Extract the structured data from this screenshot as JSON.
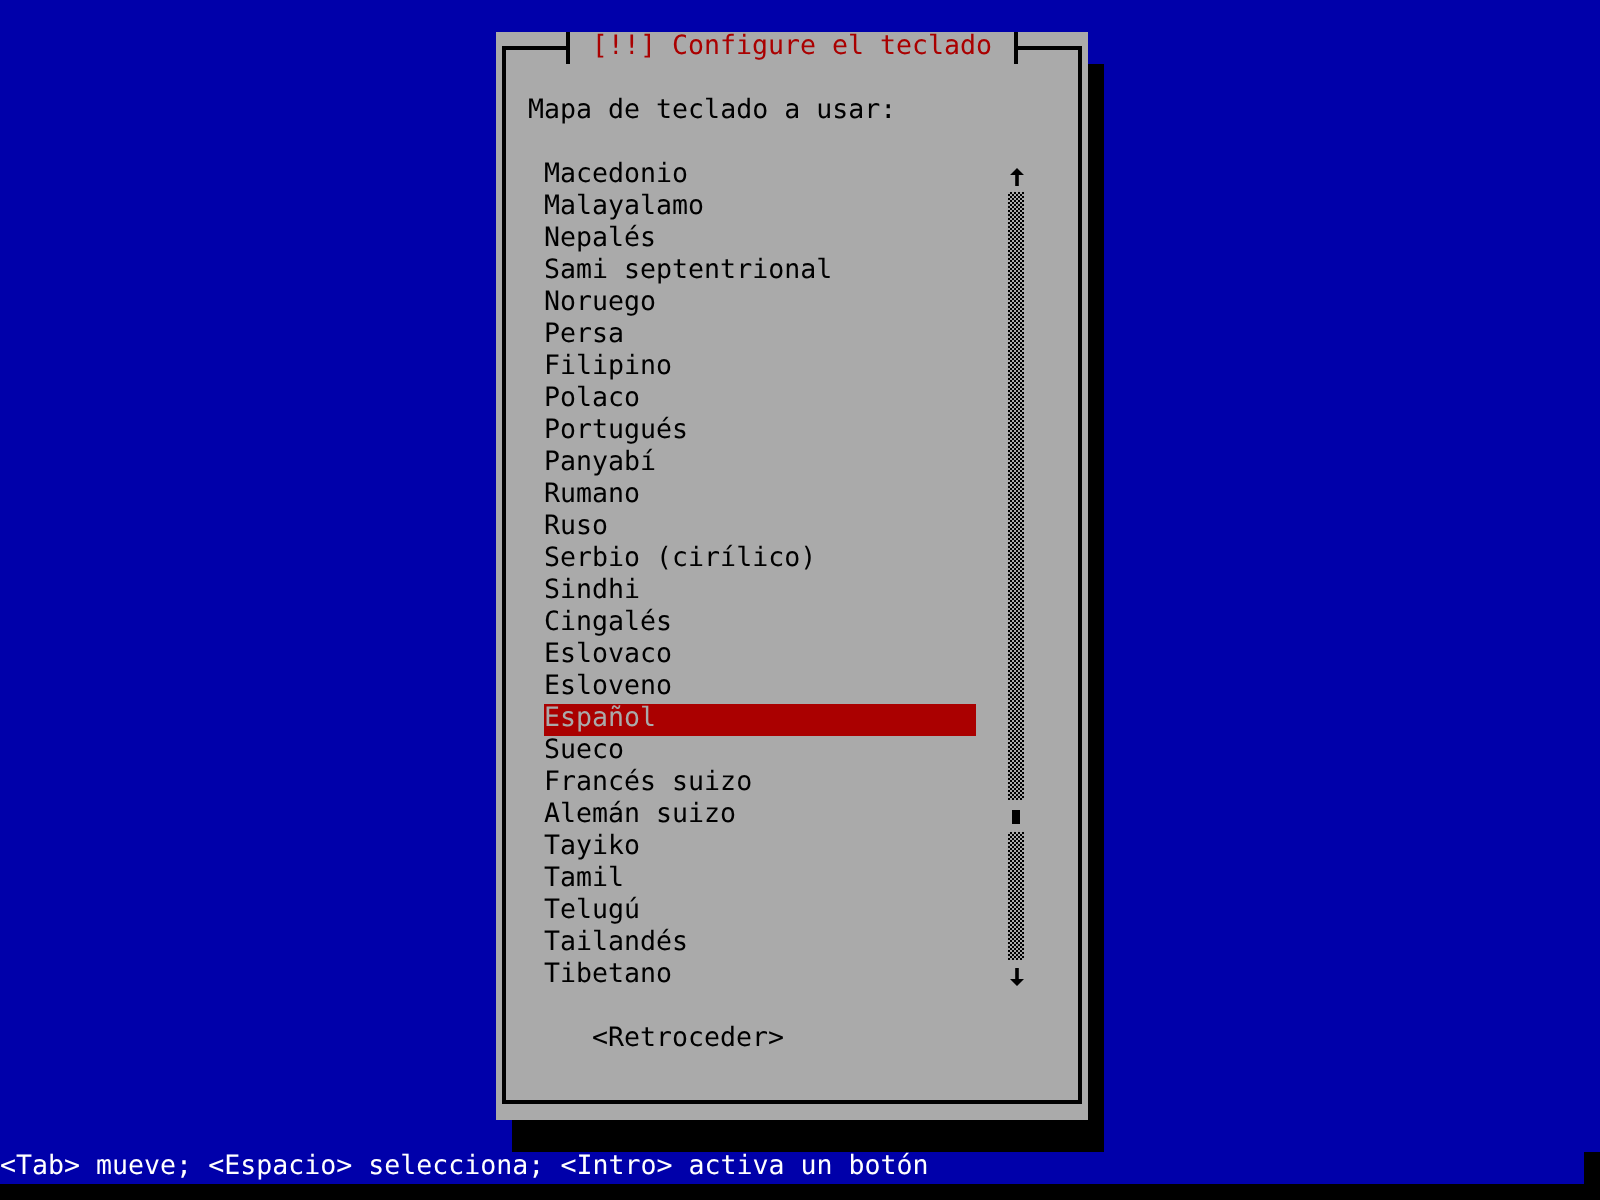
{
  "dialog": {
    "title": "[!!] Configure el teclado",
    "prompt": "Mapa de teclado a usar:",
    "keymaps": [
      {
        "label": "Macedonio",
        "selected": false
      },
      {
        "label": "Malayalamo",
        "selected": false
      },
      {
        "label": "Nepalés",
        "selected": false
      },
      {
        "label": "Sami septentrional",
        "selected": false
      },
      {
        "label": "Noruego",
        "selected": false
      },
      {
        "label": "Persa",
        "selected": false
      },
      {
        "label": "Filipino",
        "selected": false
      },
      {
        "label": "Polaco",
        "selected": false
      },
      {
        "label": "Portugués",
        "selected": false
      },
      {
        "label": "Panyabí",
        "selected": false
      },
      {
        "label": "Rumano",
        "selected": false
      },
      {
        "label": "Ruso",
        "selected": false
      },
      {
        "label": "Serbio (cirílico)",
        "selected": false
      },
      {
        "label": "Sindhi",
        "selected": false
      },
      {
        "label": "Cingalés",
        "selected": false
      },
      {
        "label": "Eslovaco",
        "selected": false
      },
      {
        "label": "Esloveno",
        "selected": false
      },
      {
        "label": "Español",
        "selected": true
      },
      {
        "label": "Sueco",
        "selected": false
      },
      {
        "label": "Francés suizo",
        "selected": false
      },
      {
        "label": "Alemán suizo",
        "selected": false
      },
      {
        "label": "Tayiko",
        "selected": false
      },
      {
        "label": "Tamil",
        "selected": false
      },
      {
        "label": "Telugú",
        "selected": false
      },
      {
        "label": "Tailandés",
        "selected": false
      },
      {
        "label": "Tibetano",
        "selected": false
      }
    ],
    "back_button": "<Retroceder>"
  },
  "status_bar": "<Tab> mueve; <Espacio> selecciona; <Intro> activa un botón"
}
